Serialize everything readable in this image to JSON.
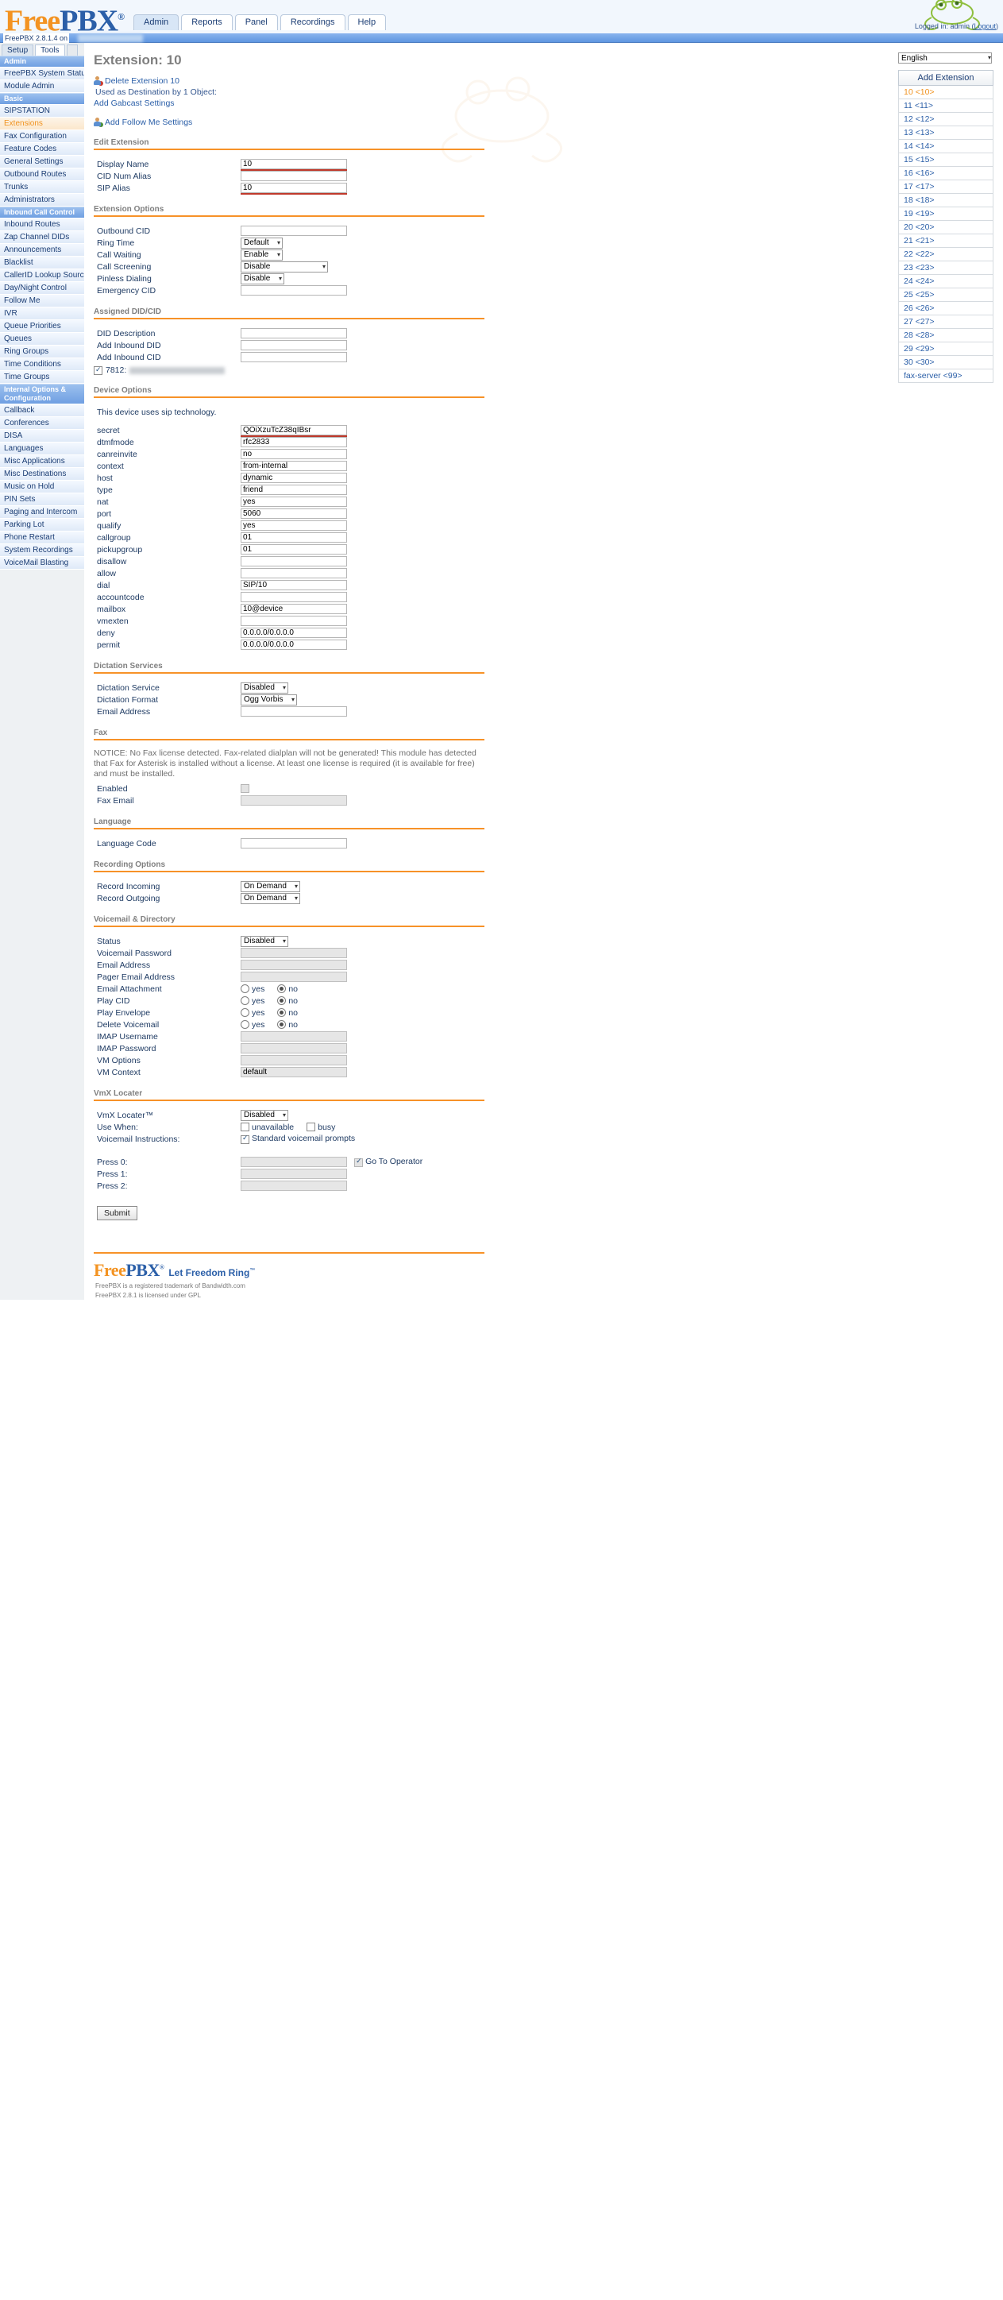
{
  "header": {
    "logo_free": "Free",
    "logo_pbx": "PBX",
    "logo_reg": "®",
    "tabs": [
      {
        "label": "Admin",
        "active": true
      },
      {
        "label": "Reports",
        "active": false
      },
      {
        "label": "Panel",
        "active": false
      },
      {
        "label": "Recordings",
        "active": false
      },
      {
        "label": "Help",
        "active": false
      }
    ],
    "login_text": "Logged in: admin (",
    "logout_label": "Logout",
    "login_text_end": ")",
    "version_line": "FreePBX 2.8.1.4 on"
  },
  "sidebar": {
    "tabs": [
      {
        "label": "Setup",
        "active": true
      },
      {
        "label": "Tools",
        "active": false
      }
    ],
    "groups": [
      {
        "label": "Admin",
        "items": [
          {
            "label": "FreePBX System Status",
            "selected": false
          },
          {
            "label": "Module Admin",
            "selected": false
          }
        ]
      },
      {
        "label": "Basic",
        "items": [
          {
            "label": "SIPSTATION",
            "selected": false
          },
          {
            "label": "Extensions",
            "selected": true
          },
          {
            "label": "Fax Configuration",
            "selected": false
          },
          {
            "label": "Feature Codes",
            "selected": false
          },
          {
            "label": "General Settings",
            "selected": false
          },
          {
            "label": "Outbound Routes",
            "selected": false
          },
          {
            "label": "Trunks",
            "selected": false
          },
          {
            "label": "Administrators",
            "selected": false
          }
        ]
      },
      {
        "label": "Inbound Call Control",
        "items": [
          {
            "label": "Inbound Routes",
            "selected": false
          },
          {
            "label": "Zap Channel DIDs",
            "selected": false
          },
          {
            "label": "Announcements",
            "selected": false
          },
          {
            "label": "Blacklist",
            "selected": false
          },
          {
            "label": "CallerID Lookup Sources",
            "selected": false
          },
          {
            "label": "Day/Night Control",
            "selected": false
          },
          {
            "label": "Follow Me",
            "selected": false
          },
          {
            "label": "IVR",
            "selected": false
          },
          {
            "label": "Queue Priorities",
            "selected": false
          },
          {
            "label": "Queues",
            "selected": false
          },
          {
            "label": "Ring Groups",
            "selected": false
          },
          {
            "label": "Time Conditions",
            "selected": false
          },
          {
            "label": "Time Groups",
            "selected": false
          }
        ]
      },
      {
        "label": "Internal Options & Configuration",
        "items": [
          {
            "label": "Callback",
            "selected": false
          },
          {
            "label": "Conferences",
            "selected": false
          },
          {
            "label": "DISA",
            "selected": false
          },
          {
            "label": "Languages",
            "selected": false
          },
          {
            "label": "Misc Applications",
            "selected": false
          },
          {
            "label": "Misc Destinations",
            "selected": false
          },
          {
            "label": "Music on Hold",
            "selected": false
          },
          {
            "label": "PIN Sets",
            "selected": false
          },
          {
            "label": "Paging and Intercom",
            "selected": false
          },
          {
            "label": "Parking Lot",
            "selected": false
          },
          {
            "label": "Phone Restart",
            "selected": false
          },
          {
            "label": "System Recordings",
            "selected": false
          },
          {
            "label": "VoiceMail Blasting",
            "selected": false
          }
        ]
      }
    ]
  },
  "main": {
    "page_title": "Extension: 10",
    "delete_link": "Delete Extension 10",
    "used_as_destination": "Used as Destination by 1 Object:",
    "add_gabcast_link": "Add Gabcast Settings",
    "add_follow_me_link": "Add Follow Me Settings",
    "edit_extension": {
      "title": "Edit Extension",
      "display_name_label": "Display Name",
      "display_name_value": "10",
      "cid_num_alias_label": "CID Num Alias",
      "cid_num_alias_value": "",
      "sip_alias_label": "SIP Alias",
      "sip_alias_value": "10"
    },
    "extension_options": {
      "title": "Extension Options",
      "outbound_cid_label": "Outbound CID",
      "outbound_cid_value": "",
      "ring_time_label": "Ring Time",
      "ring_time_value": "Default",
      "call_waiting_label": "Call Waiting",
      "call_waiting_value": "Enable",
      "call_screening_label": "Call Screening",
      "call_screening_value": "Disable",
      "pinless_dialing_label": "Pinless Dialing",
      "pinless_dialing_value": "Disable",
      "emergency_cid_label": "Emergency CID",
      "emergency_cid_value": ""
    },
    "assigned_did": {
      "title": "Assigned DID/CID",
      "did_description_label": "DID Description",
      "did_description_value": "",
      "add_inbound_did_label": "Add Inbound DID",
      "add_inbound_did_value": "",
      "add_inbound_cid_label": "Add Inbound CID",
      "add_inbound_cid_value": "",
      "existing_did_label": "7812:"
    },
    "device_options": {
      "title": "Device Options",
      "tech_note": "This device uses sip technology.",
      "fields": [
        {
          "label": "secret",
          "value": "QOiXzuTcZ38qIBsr",
          "highlight": true
        },
        {
          "label": "dtmfmode",
          "value": "rfc2833",
          "highlight": false
        },
        {
          "label": "canreinvite",
          "value": "no",
          "highlight": false
        },
        {
          "label": "context",
          "value": "from-internal",
          "highlight": false
        },
        {
          "label": "host",
          "value": "dynamic",
          "highlight": false
        },
        {
          "label": "type",
          "value": "friend",
          "highlight": false
        },
        {
          "label": "nat",
          "value": "yes",
          "highlight": false
        },
        {
          "label": "port",
          "value": "5060",
          "highlight": false
        },
        {
          "label": "qualify",
          "value": "yes",
          "highlight": false
        },
        {
          "label": "callgroup",
          "value": "01",
          "highlight": false
        },
        {
          "label": "pickupgroup",
          "value": "01",
          "highlight": false
        },
        {
          "label": "disallow",
          "value": "",
          "highlight": false
        },
        {
          "label": "allow",
          "value": "",
          "highlight": false
        },
        {
          "label": "dial",
          "value": "SIP/10",
          "highlight": false
        },
        {
          "label": "accountcode",
          "value": "",
          "highlight": false
        },
        {
          "label": "mailbox",
          "value": "10@device",
          "highlight": false
        },
        {
          "label": "vmexten",
          "value": "",
          "highlight": false
        },
        {
          "label": "deny",
          "value": "0.0.0.0/0.0.0.0",
          "highlight": false
        },
        {
          "label": "permit",
          "value": "0.0.0.0/0.0.0.0",
          "highlight": false
        }
      ]
    },
    "dictation": {
      "title": "Dictation Services",
      "service_label": "Dictation Service",
      "service_value": "Disabled",
      "format_label": "Dictation Format",
      "format_value": "Ogg Vorbis",
      "email_label": "Email Address",
      "email_value": ""
    },
    "fax": {
      "title": "Fax",
      "notice": "NOTICE: No Fax license detected. Fax-related dialplan will not be generated! This module has detected that Fax for Asterisk is installed without a license. At least one license is required (it is available for free) and must be installed.",
      "enabled_label": "Enabled",
      "fax_email_label": "Fax Email",
      "fax_email_value": ""
    },
    "language": {
      "title": "Language",
      "code_label": "Language Code",
      "code_value": ""
    },
    "recording": {
      "title": "Recording Options",
      "incoming_label": "Record Incoming",
      "incoming_value": "On Demand",
      "outgoing_label": "Record Outgoing",
      "outgoing_value": "On Demand"
    },
    "voicemail": {
      "title": "Voicemail & Directory",
      "status_label": "Status",
      "status_value": "Disabled",
      "password_label": "Voicemail Password",
      "password_value": "",
      "email_label": "Email Address",
      "email_value": "",
      "pager_label": "Pager Email Address",
      "pager_value": "",
      "attachment_label": "Email Attachment",
      "play_cid_label": "Play CID",
      "play_envelope_label": "Play Envelope",
      "delete_vm_label": "Delete Voicemail",
      "imap_user_label": "IMAP Username",
      "imap_user_value": "",
      "imap_pass_label": "IMAP Password",
      "imap_pass_value": "",
      "vm_options_label": "VM Options",
      "vm_options_value": "",
      "vm_context_label": "VM Context",
      "vm_context_value": "default",
      "yes_label": "yes",
      "no_label": "no"
    },
    "vmx": {
      "title": "VmX Locater",
      "locater_label": "VmX Locater™",
      "locater_value": "Disabled",
      "use_when_label": "Use When:",
      "unavailable_label": "unavailable",
      "busy_label": "busy",
      "instructions_label": "Voicemail Instructions:",
      "standard_prompts_label": "Standard voicemail prompts",
      "press0_label": "Press 0:",
      "press0_value": "",
      "goto_operator_label": "Go To Operator",
      "press1_label": "Press 1:",
      "press1_value": "",
      "press2_label": "Press 2:",
      "press2_value": ""
    },
    "submit_label": "Submit"
  },
  "right": {
    "language_value": "English",
    "add_extension_label": "Add Extension",
    "extensions": [
      {
        "label": "10 <10>",
        "selected": true
      },
      {
        "label": "11 <11>",
        "selected": false
      },
      {
        "label": "12 <12>",
        "selected": false
      },
      {
        "label": "13 <13>",
        "selected": false
      },
      {
        "label": "14 <14>",
        "selected": false
      },
      {
        "label": "15 <15>",
        "selected": false
      },
      {
        "label": "16 <16>",
        "selected": false
      },
      {
        "label": "17 <17>",
        "selected": false
      },
      {
        "label": "18 <18>",
        "selected": false
      },
      {
        "label": "19 <19>",
        "selected": false
      },
      {
        "label": "20 <20>",
        "selected": false
      },
      {
        "label": "21 <21>",
        "selected": false
      },
      {
        "label": "22 <22>",
        "selected": false
      },
      {
        "label": "23 <23>",
        "selected": false
      },
      {
        "label": "24 <24>",
        "selected": false
      },
      {
        "label": "25 <25>",
        "selected": false
      },
      {
        "label": "26 <26>",
        "selected": false
      },
      {
        "label": "27 <27>",
        "selected": false
      },
      {
        "label": "28 <28>",
        "selected": false
      },
      {
        "label": "29 <29>",
        "selected": false
      },
      {
        "label": "30 <30>",
        "selected": false
      },
      {
        "label": "fax-server <99>",
        "selected": false
      }
    ]
  },
  "footer": {
    "logo_free": "Free",
    "logo_pbx": "PBX",
    "logo_reg": "®",
    "tagline": "Let Freedom Ring",
    "tagline_tm": "™",
    "line1": "FreePBX is a registered trademark of Bandwidth.com",
    "line2": "FreePBX 2.8.1 is licensed under GPL"
  },
  "colors": {
    "accent_orange": "#f79228",
    "link_blue": "#2b5fa8",
    "selected_orange": "#f0921f"
  }
}
